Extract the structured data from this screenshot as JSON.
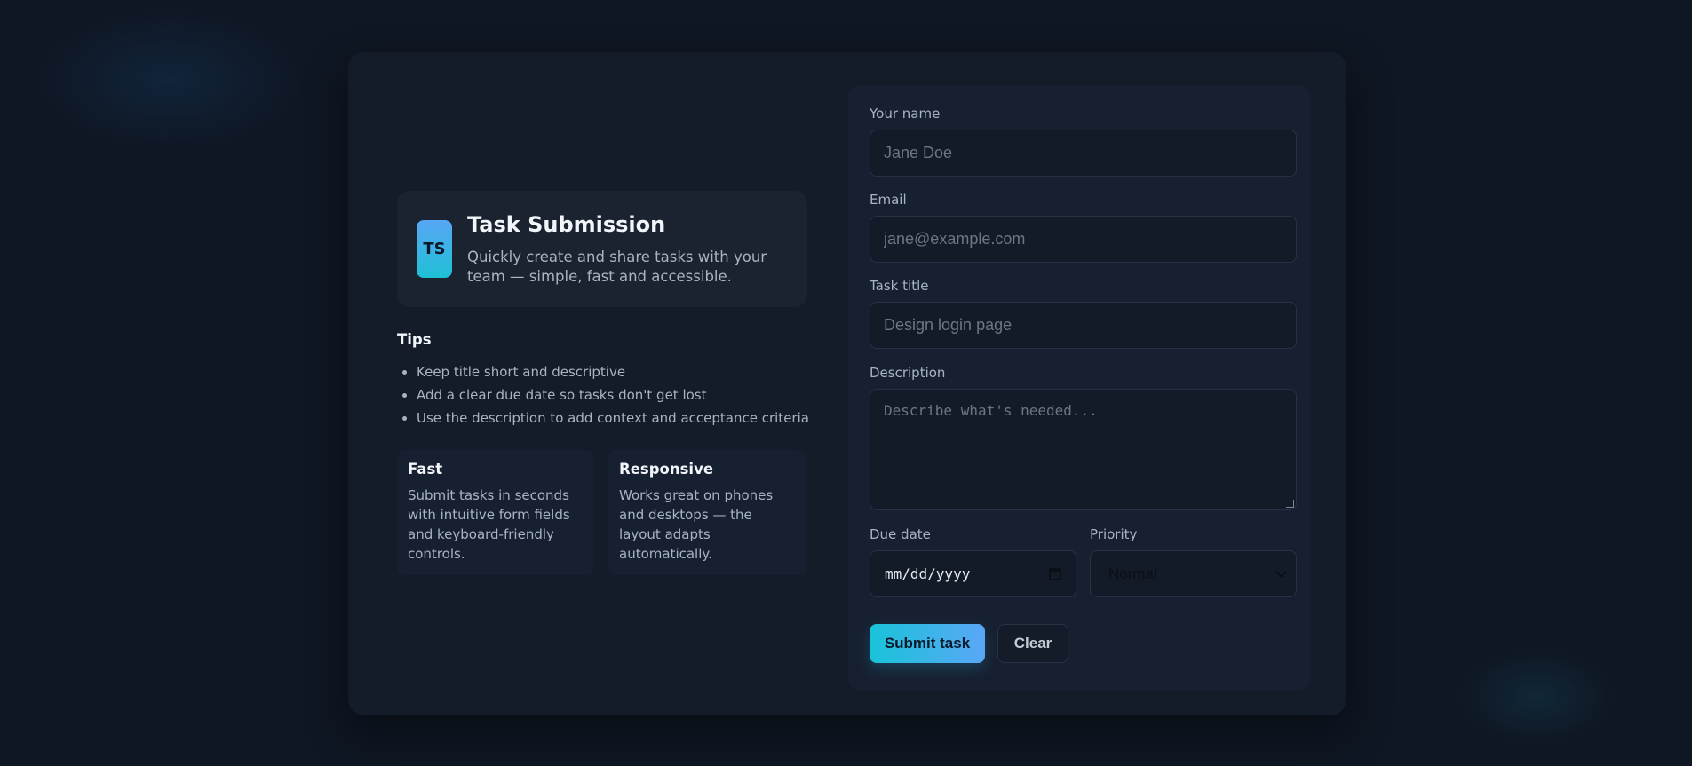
{
  "hero": {
    "logo_text": "TS",
    "title": "Task Submission",
    "subtitle": "Quickly create and share tasks with your team — simple, fast and accessible."
  },
  "tips": {
    "title": "Tips",
    "items": [
      "Keep title short and descriptive",
      "Add a clear due date so tasks don't get lost",
      "Use the description to add context and acceptance criteria"
    ]
  },
  "features": [
    {
      "title": "Fast",
      "text": "Submit tasks in seconds with intuitive form fields and keyboard-friendly controls."
    },
    {
      "title": "Responsive",
      "text": "Works great on phones and desktops — the layout adapts automatically."
    }
  ],
  "form": {
    "name": {
      "label": "Your name",
      "placeholder": "Jane Doe",
      "value": ""
    },
    "email": {
      "label": "Email",
      "placeholder": "jane@example.com",
      "value": ""
    },
    "task_title": {
      "label": "Task title",
      "placeholder": "Design login page",
      "value": ""
    },
    "description": {
      "label": "Description",
      "placeholder": "Describe what's needed...",
      "value": ""
    },
    "due_date": {
      "label": "Due date",
      "value": "mm/dd/yyyy",
      "icon": "calendar-icon"
    },
    "priority": {
      "label": "Priority",
      "selected": "Normal",
      "icon": "chevron-down-icon"
    },
    "submit_label": "Submit task",
    "clear_label": "Clear"
  },
  "colors": {
    "background": "#0f1724",
    "card": "#141c29",
    "accent_start": "#19c3d9",
    "accent_end": "#5aa7f6"
  }
}
